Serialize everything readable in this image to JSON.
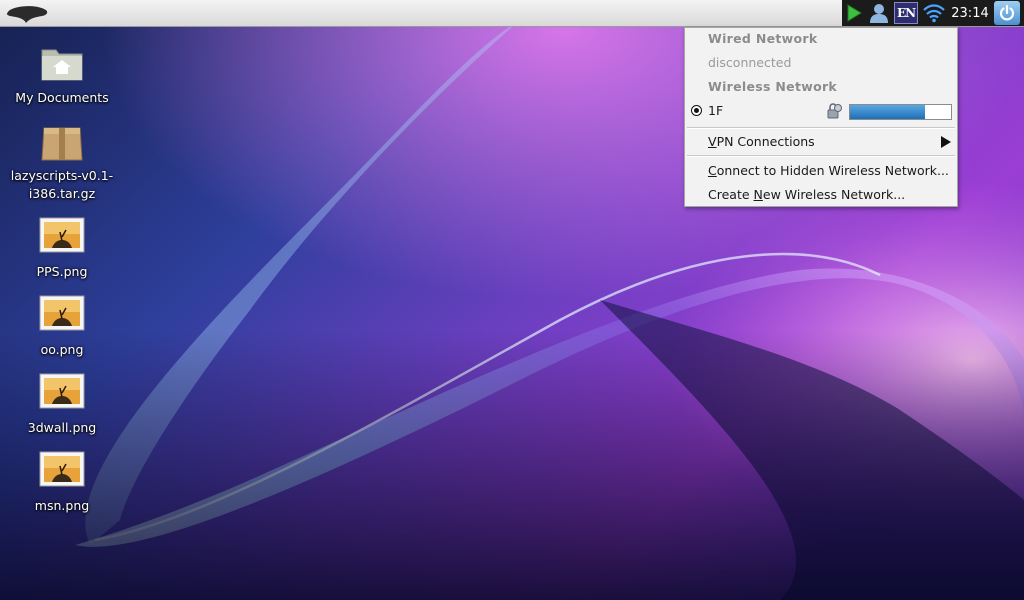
{
  "panel": {
    "clock": "23:14",
    "language": "EN",
    "icons": [
      "menu-logo",
      "play-icon",
      "user-icon",
      "language-indicator",
      "wifi-icon",
      "power-icon"
    ]
  },
  "desktop": {
    "icons": [
      {
        "label": "My Documents",
        "icon": "folder-icon"
      },
      {
        "label": "lazyscripts-v0.1-i386.tar.gz",
        "icon": "package-icon"
      },
      {
        "label": "PPS.png",
        "icon": "image-icon"
      },
      {
        "label": "oo.png",
        "icon": "image-icon"
      },
      {
        "label": "3dwall.png",
        "icon": "image-icon"
      },
      {
        "label": "msn.png",
        "icon": "image-icon"
      }
    ]
  },
  "network_menu": {
    "wired_header": "Wired Network",
    "wired_status": "disconnected",
    "wireless_header": "Wireless Network",
    "network": {
      "name": "1F",
      "selected": true,
      "secured": true,
      "signal": 0.74
    },
    "vpn": {
      "accel": "V",
      "rest": "PN Connections"
    },
    "hidden": {
      "accel": "C",
      "rest": "onnect to Hidden Wireless Network..."
    },
    "create": {
      "pre": "Create ",
      "accel": "N",
      "rest": "ew Wireless Network..."
    }
  },
  "colors": {
    "panel": "#e3e3e3",
    "tray": "#1b1b1b",
    "signal": "#2a7ac4",
    "menu_bg": "#f2f2f2"
  }
}
